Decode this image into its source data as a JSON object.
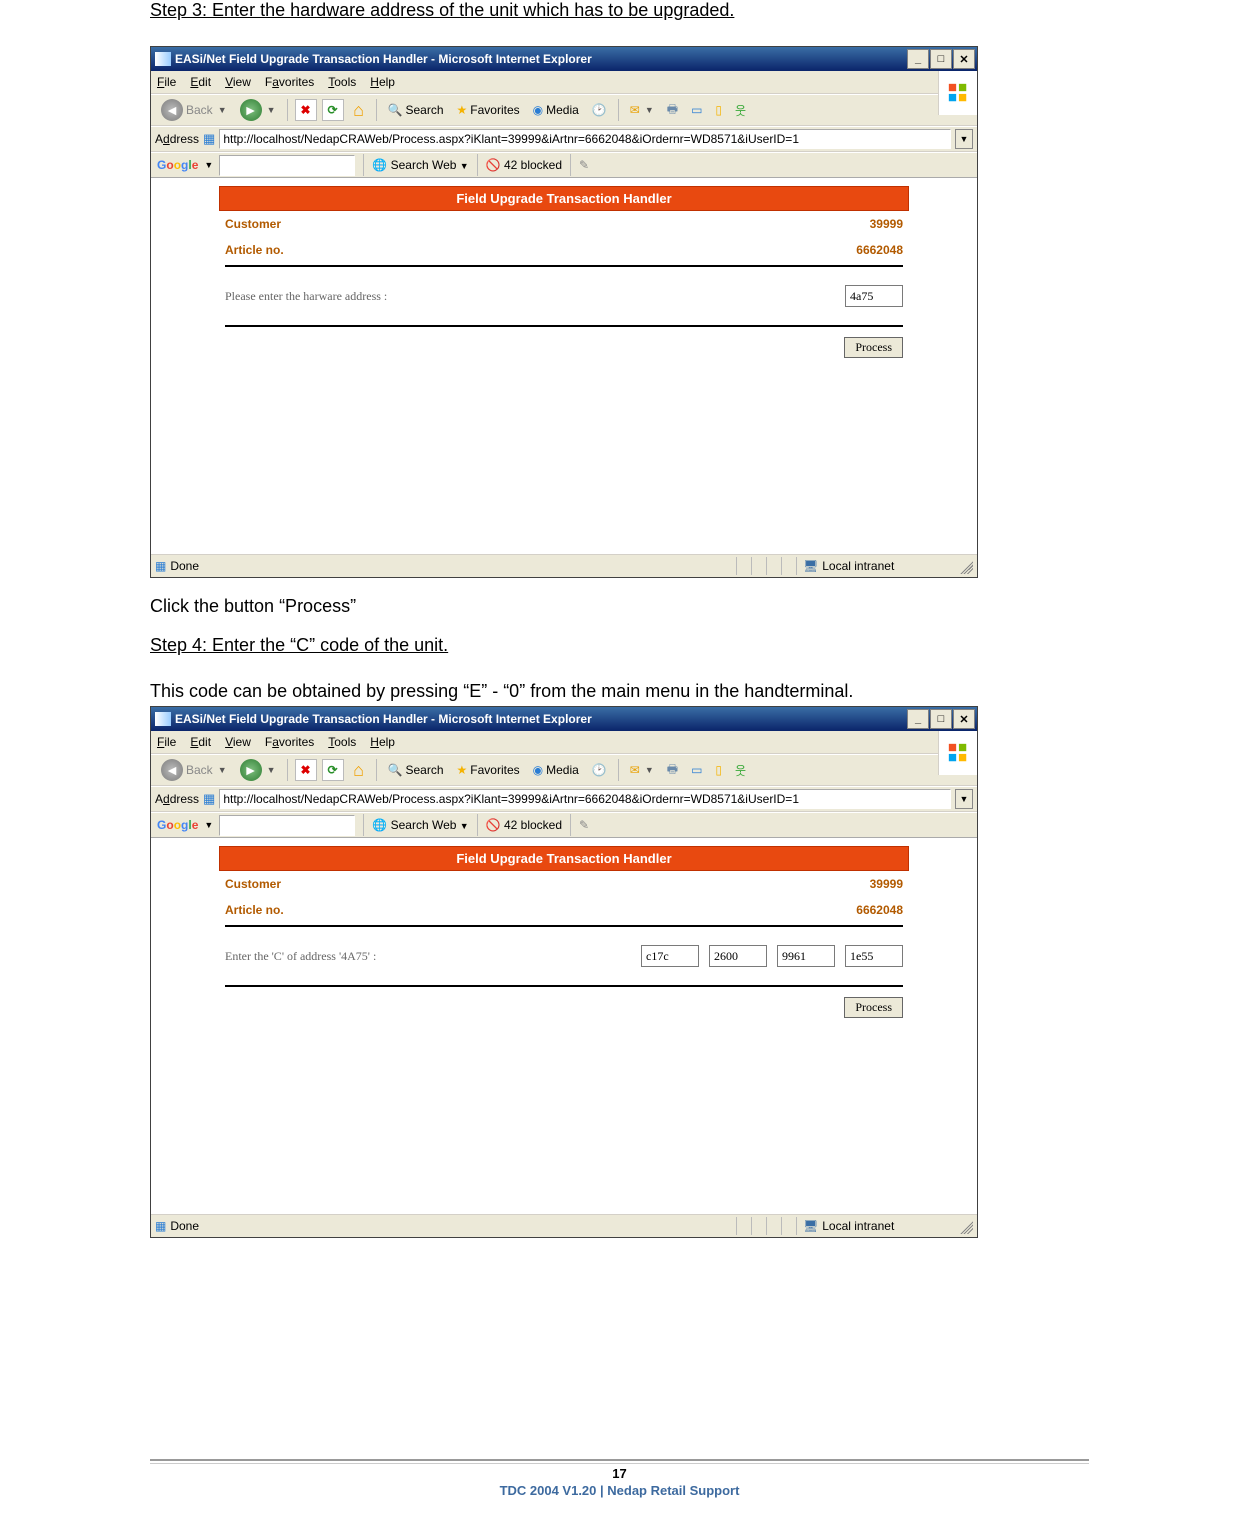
{
  "steps": {
    "step3_heading": "Step 3: Enter the hardware address of the unit which has to be upgraded.",
    "step3_instruction": "Click the button “Process”",
    "step4_heading": "Step 4: Enter the “C” code of the unit.",
    "step4_instruction": "This code can be obtained by pressing “E” - “0” from the main menu in the handterminal."
  },
  "ie": {
    "title": "EASi/Net Field Upgrade Transaction Handler - Microsoft Internet Explorer",
    "menus": [
      "File",
      "Edit",
      "View",
      "Favorites",
      "Tools",
      "Help"
    ],
    "toolbar": {
      "back": "Back",
      "search": "Search",
      "favorites": "Favorites",
      "media": "Media"
    },
    "address_label": "Address",
    "address_value": "http://localhost/NedapCRAWeb/Process.aspx?iKlant=39999&iArtnr=6662048&iOrdernr=WD8571&iUserID=1",
    "google": {
      "label": "Google",
      "search_web": "Search Web",
      "blocked": "42 blocked"
    },
    "status_done": "Done",
    "status_zone": "Local intranet"
  },
  "panel": {
    "header": "Field Upgrade Transaction Handler",
    "customer_label": "Customer",
    "customer_value": "39999",
    "article_label": "Article no.",
    "article_value": "6662048",
    "hw_prompt": "Please enter the harware address :",
    "hw_value": "4a75",
    "c_prompt": "Enter the 'C' of address '4A75' :",
    "c_values": [
      "c17c",
      "2600",
      "9961",
      "1e55"
    ],
    "process_btn": "Process"
  },
  "footer": {
    "page_number": "17",
    "line": "TDC 2004 V1.20 | Nedap Retail Support"
  }
}
